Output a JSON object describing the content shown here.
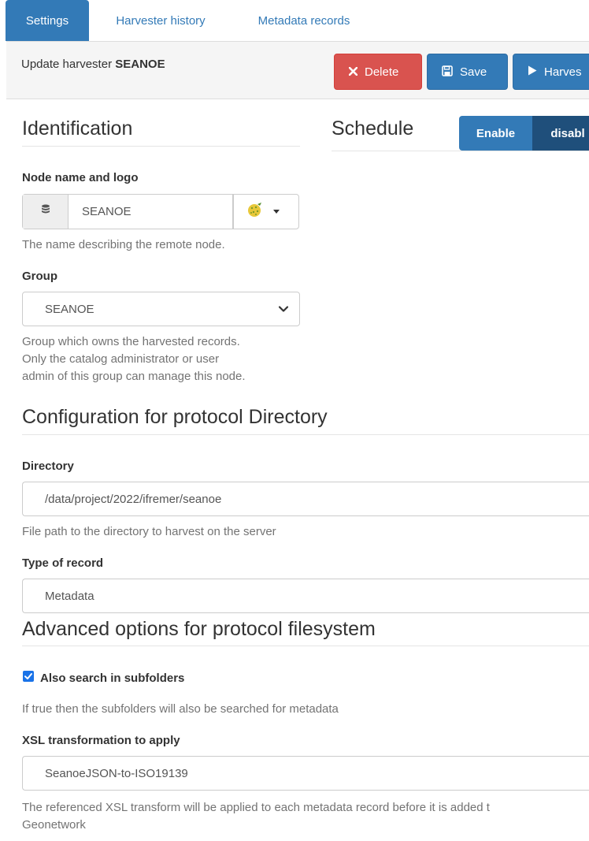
{
  "tabs": [
    {
      "label": "Settings",
      "active": true
    },
    {
      "label": "Harvester history",
      "active": false
    },
    {
      "label": "Metadata records",
      "active": false
    }
  ],
  "header": {
    "title_prefix": "Update harvester",
    "title_name": "SEANOE"
  },
  "actions": {
    "delete_label": "Delete",
    "save_label": "Save",
    "harvest_label": "Harves"
  },
  "identification": {
    "title": "Identification",
    "node_label": "Node name and logo",
    "node_value": "SEANOE",
    "node_help": "The name describing the remote node.",
    "group_label": "Group",
    "group_value": "SEANOE",
    "group_help": [
      "Group which owns the harvested records.",
      "Only the catalog administrator or user",
      "admin of this group can manage this node."
    ]
  },
  "schedule": {
    "title": "Schedule",
    "enable_label": "Enable",
    "disable_label": "disabl"
  },
  "protocol": {
    "title": "Configuration for protocol Directory",
    "directory_label": "Directory",
    "directory_value": "/data/project/2022/ifremer/seanoe",
    "directory_help": "File path to the directory to harvest on the server",
    "type_label": "Type of record",
    "type_value": "Metadata"
  },
  "advanced": {
    "title": "Advanced options for protocol filesystem",
    "subfolders_label": "Also search in subfolders",
    "subfolders_checked": true,
    "subfolders_help": "If true then the subfolders will also be searched for metadata",
    "xsl_label": "XSL transformation to apply",
    "xsl_value": "SeanoeJSON-to-ISO19139",
    "xsl_help": [
      "The referenced XSL transform will be applied to each metadata record before it is added t",
      "Geonetwork"
    ]
  },
  "colors": {
    "primary": "#337ab7",
    "danger": "#d9534f",
    "toggle_dark": "#1f4f7b"
  },
  "icons": {
    "delete": "times-icon",
    "save": "floppy-icon",
    "harvest": "play-icon",
    "node": "database-icon",
    "logo": "logo-thumbnail-icon",
    "logo_dropdown": "caret-down-icon",
    "group_dropdown": "chevron-down-icon",
    "subfolders": "checkbox-checked-icon"
  }
}
